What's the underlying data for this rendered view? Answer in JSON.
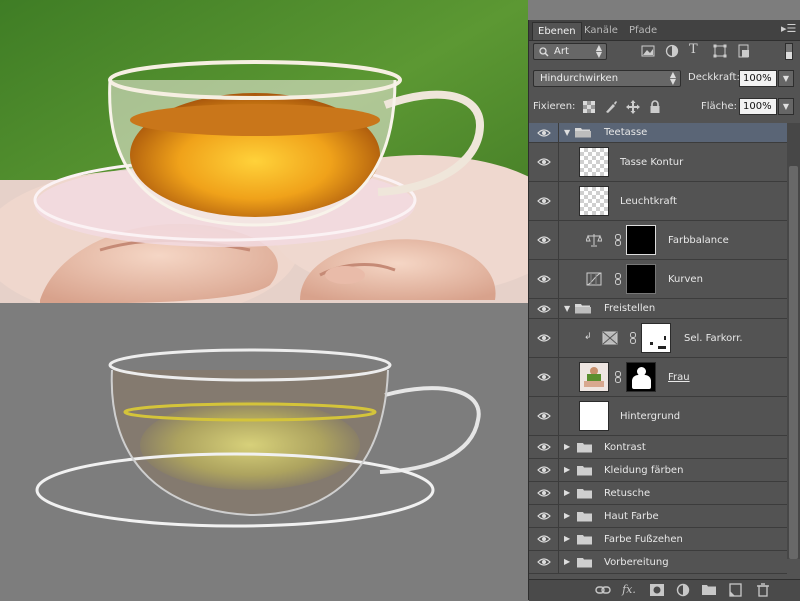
{
  "panel": {
    "tabs": [
      "Ebenen",
      "Kanäle",
      "Pfade"
    ],
    "active_tab": "Ebenen",
    "filter": {
      "value": "Art"
    },
    "blend_mode": "Hindurchwirken",
    "opacity": {
      "label": "Deckkraft:",
      "value": "100%"
    },
    "lock": {
      "label": "Fixieren:"
    },
    "fill": {
      "label": "Fläche:",
      "value": "100%"
    }
  },
  "layers": [
    {
      "name": "Teetasse",
      "kind": "group",
      "expanded": true,
      "selected": true
    },
    {
      "name": "Tasse Kontur",
      "kind": "pixel",
      "thumbnail": "transparent"
    },
    {
      "name": "Leuchtkraft",
      "kind": "pixel",
      "thumbnail": "transparent"
    },
    {
      "name": "Farbbalance",
      "kind": "adjustment",
      "icon": "balance-scale-icon",
      "mask": "black"
    },
    {
      "name": "Kurven",
      "kind": "adjustment",
      "icon": "curves-icon",
      "mask": "black"
    },
    {
      "name": "Freistellen",
      "kind": "group",
      "expanded": true
    },
    {
      "name": "Sel. Farkorr.",
      "kind": "adjustment",
      "icon": "selective-color-icon",
      "mask": "white-with-dark",
      "clipped": true
    },
    {
      "name": "Frau",
      "kind": "pixel",
      "thumbnail": "photo",
      "mask": "silhouette",
      "underlined": true
    },
    {
      "name": "Hintergrund",
      "kind": "pixel",
      "thumbnail": "white"
    },
    {
      "name": "Kontrast",
      "kind": "group",
      "expanded": false
    },
    {
      "name": "Kleidung färben",
      "kind": "group",
      "expanded": false
    },
    {
      "name": "Retusche",
      "kind": "group",
      "expanded": false
    },
    {
      "name": "Haut Farbe",
      "kind": "group",
      "expanded": false
    },
    {
      "name": "Farbe Fußzehen",
      "kind": "group",
      "expanded": false
    },
    {
      "name": "Vorbereitung",
      "kind": "group",
      "expanded": false
    }
  ],
  "bottom_icons": [
    "link-icon",
    "fx-icon",
    "add-mask-icon",
    "adjustment-layer-icon",
    "new-group-icon",
    "new-layer-icon",
    "trash-icon"
  ],
  "colors": {
    "panel_bg": "#535353",
    "selected_row": "#5a6576",
    "canvas_gray": "#7d7d7d",
    "shirt_green": "#4f8a2c",
    "tea_amber": "#e08a10"
  }
}
